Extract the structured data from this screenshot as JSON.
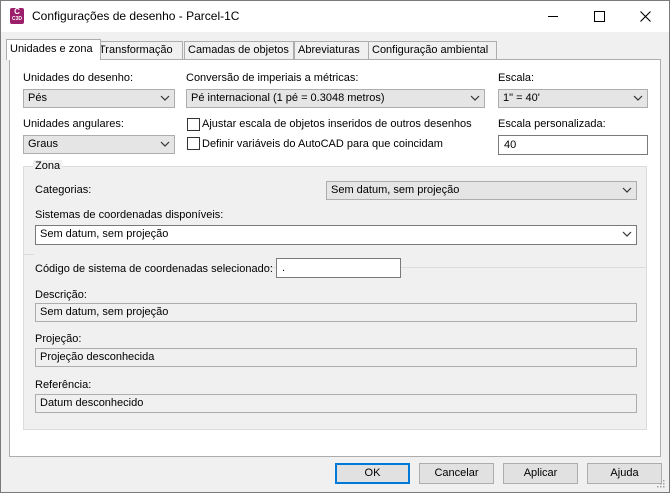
{
  "window": {
    "title": "Configurações de desenho - Parcel-1C",
    "app_icon_top": "C",
    "app_icon_bottom": "C3D",
    "icons": {
      "app": "civil3d-app-icon",
      "minimize": "minimize-icon",
      "maximize": "maximize-icon",
      "close": "close-icon"
    }
  },
  "tabs": [
    {
      "label": "Unidades e zona",
      "active": true
    },
    {
      "label": "Transformação",
      "active": false
    },
    {
      "label": "Camadas de objetos",
      "active": false
    },
    {
      "label": "Abreviaturas",
      "active": false
    },
    {
      "label": "Configuração ambiental",
      "active": false
    }
  ],
  "units": {
    "drawing_units_label": "Unidades do desenho:",
    "drawing_units_value": "Pés",
    "angular_units_label": "Unidades angulares:",
    "angular_units_value": "Graus",
    "imperial_label": "Conversão de imperiais a métricas:",
    "imperial_value": "Pé internacional (1 pé = 0.3048 metros)",
    "scale_objects_label": "Ajustar escala de objetos inseridos de outros desenhos",
    "scale_objects_checked": false,
    "autocad_vars_label": "Definir variáveis do AutoCAD para que coincidam",
    "autocad_vars_checked": false,
    "scale_label": "Escala:",
    "scale_value": "1\" = 40'",
    "custom_scale_label": "Escala personalizada:",
    "custom_scale_value": "40"
  },
  "zone": {
    "group_label": "Zona",
    "categories_label": "Categorias:",
    "categories_value": "Sem datum, sem projeção",
    "available_cs_label": "Sistemas de coordenadas disponíveis:",
    "available_cs_value": "Sem datum, sem projeção",
    "selected_code_label": "Código de sistema de coordenadas selecionado:",
    "selected_code_value": ".",
    "description_label": "Descrição:",
    "description_value": "Sem datum, sem projeção",
    "projection_label": "Projeção:",
    "projection_value": "Projeção desconhecida",
    "reference_label": "Referência:",
    "reference_value": "Datum desconhecido"
  },
  "buttons": {
    "ok": "OK",
    "cancel": "Cancelar",
    "apply": "Aplicar",
    "help": "Ajuda"
  },
  "colors": {
    "accent": "#0078d7",
    "app_icon": "#9b1f6b"
  }
}
